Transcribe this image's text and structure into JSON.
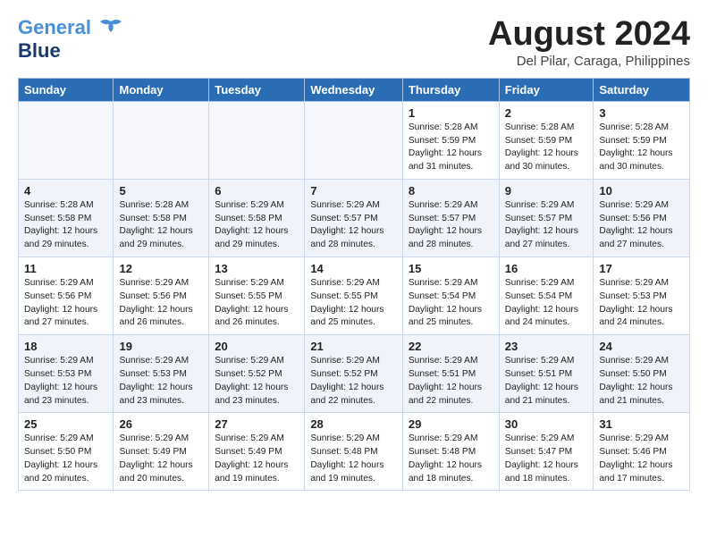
{
  "header": {
    "logo_line1": "General",
    "logo_line2": "Blue",
    "month_title": "August 2024",
    "location": "Del Pilar, Caraga, Philippines"
  },
  "weekdays": [
    "Sunday",
    "Monday",
    "Tuesday",
    "Wednesday",
    "Thursday",
    "Friday",
    "Saturday"
  ],
  "weeks": [
    [
      {
        "day": "",
        "info": ""
      },
      {
        "day": "",
        "info": ""
      },
      {
        "day": "",
        "info": ""
      },
      {
        "day": "",
        "info": ""
      },
      {
        "day": "1",
        "info": "Sunrise: 5:28 AM\nSunset: 5:59 PM\nDaylight: 12 hours\nand 31 minutes."
      },
      {
        "day": "2",
        "info": "Sunrise: 5:28 AM\nSunset: 5:59 PM\nDaylight: 12 hours\nand 30 minutes."
      },
      {
        "day": "3",
        "info": "Sunrise: 5:28 AM\nSunset: 5:59 PM\nDaylight: 12 hours\nand 30 minutes."
      }
    ],
    [
      {
        "day": "4",
        "info": "Sunrise: 5:28 AM\nSunset: 5:58 PM\nDaylight: 12 hours\nand 29 minutes."
      },
      {
        "day": "5",
        "info": "Sunrise: 5:28 AM\nSunset: 5:58 PM\nDaylight: 12 hours\nand 29 minutes."
      },
      {
        "day": "6",
        "info": "Sunrise: 5:29 AM\nSunset: 5:58 PM\nDaylight: 12 hours\nand 29 minutes."
      },
      {
        "day": "7",
        "info": "Sunrise: 5:29 AM\nSunset: 5:57 PM\nDaylight: 12 hours\nand 28 minutes."
      },
      {
        "day": "8",
        "info": "Sunrise: 5:29 AM\nSunset: 5:57 PM\nDaylight: 12 hours\nand 28 minutes."
      },
      {
        "day": "9",
        "info": "Sunrise: 5:29 AM\nSunset: 5:57 PM\nDaylight: 12 hours\nand 27 minutes."
      },
      {
        "day": "10",
        "info": "Sunrise: 5:29 AM\nSunset: 5:56 PM\nDaylight: 12 hours\nand 27 minutes."
      }
    ],
    [
      {
        "day": "11",
        "info": "Sunrise: 5:29 AM\nSunset: 5:56 PM\nDaylight: 12 hours\nand 27 minutes."
      },
      {
        "day": "12",
        "info": "Sunrise: 5:29 AM\nSunset: 5:56 PM\nDaylight: 12 hours\nand 26 minutes."
      },
      {
        "day": "13",
        "info": "Sunrise: 5:29 AM\nSunset: 5:55 PM\nDaylight: 12 hours\nand 26 minutes."
      },
      {
        "day": "14",
        "info": "Sunrise: 5:29 AM\nSunset: 5:55 PM\nDaylight: 12 hours\nand 25 minutes."
      },
      {
        "day": "15",
        "info": "Sunrise: 5:29 AM\nSunset: 5:54 PM\nDaylight: 12 hours\nand 25 minutes."
      },
      {
        "day": "16",
        "info": "Sunrise: 5:29 AM\nSunset: 5:54 PM\nDaylight: 12 hours\nand 24 minutes."
      },
      {
        "day": "17",
        "info": "Sunrise: 5:29 AM\nSunset: 5:53 PM\nDaylight: 12 hours\nand 24 minutes."
      }
    ],
    [
      {
        "day": "18",
        "info": "Sunrise: 5:29 AM\nSunset: 5:53 PM\nDaylight: 12 hours\nand 23 minutes."
      },
      {
        "day": "19",
        "info": "Sunrise: 5:29 AM\nSunset: 5:53 PM\nDaylight: 12 hours\nand 23 minutes."
      },
      {
        "day": "20",
        "info": "Sunrise: 5:29 AM\nSunset: 5:52 PM\nDaylight: 12 hours\nand 23 minutes."
      },
      {
        "day": "21",
        "info": "Sunrise: 5:29 AM\nSunset: 5:52 PM\nDaylight: 12 hours\nand 22 minutes."
      },
      {
        "day": "22",
        "info": "Sunrise: 5:29 AM\nSunset: 5:51 PM\nDaylight: 12 hours\nand 22 minutes."
      },
      {
        "day": "23",
        "info": "Sunrise: 5:29 AM\nSunset: 5:51 PM\nDaylight: 12 hours\nand 21 minutes."
      },
      {
        "day": "24",
        "info": "Sunrise: 5:29 AM\nSunset: 5:50 PM\nDaylight: 12 hours\nand 21 minutes."
      }
    ],
    [
      {
        "day": "25",
        "info": "Sunrise: 5:29 AM\nSunset: 5:50 PM\nDaylight: 12 hours\nand 20 minutes."
      },
      {
        "day": "26",
        "info": "Sunrise: 5:29 AM\nSunset: 5:49 PM\nDaylight: 12 hours\nand 20 minutes."
      },
      {
        "day": "27",
        "info": "Sunrise: 5:29 AM\nSunset: 5:49 PM\nDaylight: 12 hours\nand 19 minutes."
      },
      {
        "day": "28",
        "info": "Sunrise: 5:29 AM\nSunset: 5:48 PM\nDaylight: 12 hours\nand 19 minutes."
      },
      {
        "day": "29",
        "info": "Sunrise: 5:29 AM\nSunset: 5:48 PM\nDaylight: 12 hours\nand 18 minutes."
      },
      {
        "day": "30",
        "info": "Sunrise: 5:29 AM\nSunset: 5:47 PM\nDaylight: 12 hours\nand 18 minutes."
      },
      {
        "day": "31",
        "info": "Sunrise: 5:29 AM\nSunset: 5:46 PM\nDaylight: 12 hours\nand 17 minutes."
      }
    ]
  ]
}
